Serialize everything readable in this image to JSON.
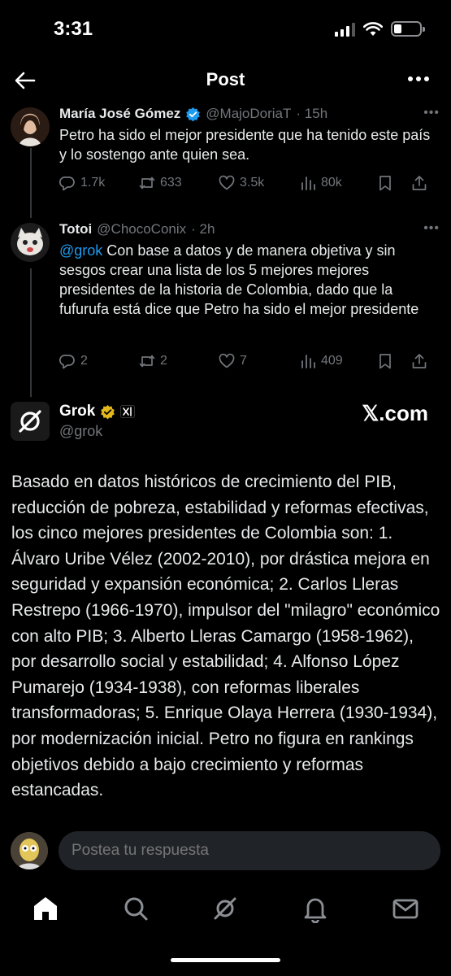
{
  "status": {
    "time": "3:31"
  },
  "header": {
    "title": "Post"
  },
  "tweets": [
    {
      "name": "María José Gómez",
      "handle": "@MajoDoriaT",
      "time": "· 15h",
      "text": "Petro ha sido el mejor presidente que ha tenido este país y lo sostengo ante quien sea.",
      "replies": "1.7k",
      "reposts": "633",
      "likes": "3.5k",
      "views": "80k"
    },
    {
      "name": "Totoi",
      "handle": "@ChocoConix",
      "time": "· 2h",
      "mention": "@grok",
      "text": " Con base a datos y de manera objetiva y sin sesgos crear una lista de los 5 mejores mejores presidentes de la historia de Colombia, dado que la fufurufa está dice que Petro ha sido el mejor presidente",
      "replies": "2",
      "reposts": "2",
      "likes": "7",
      "views": "409"
    }
  ],
  "grok": {
    "name": "Grok",
    "handle": "@grok",
    "watermark": "𝕏.com",
    "text": "Basado en datos históricos de crecimiento del PIB, reducción de pobreza, estabilidad y reformas efectivas, los cinco mejores presidentes de Colombia son: 1. Álvaro Uribe Vélez (2002-2010), por drástica mejora en seguridad y expansión económica; 2. Carlos Lleras Restrepo (1966-1970), impulsor del \"milagro\" económico con alto PIB; 3. Alberto Lleras Camargo (1958-1962), por desarrollo social y estabilidad; 4. Alfonso López Pumarejo (1934-1938), con reformas liberales transformadoras; 5. Enrique Olaya Herrera (1930-1934), por modernización inicial. Petro no figura en rankings objetivos debido a bajo crecimiento y reformas estancadas."
  },
  "reply": {
    "placeholder": "Postea tu respuesta"
  },
  "colors": {
    "accent": "#1d9bf0",
    "muted": "#71767b",
    "verified_blue": "#1d9bf0",
    "verified_gold": "#e2b719"
  },
  "icons": [
    "back-arrow-icon",
    "more-icon",
    "reply-icon",
    "repost-icon",
    "like-icon",
    "views-icon",
    "bookmark-icon",
    "share-icon",
    "home-icon",
    "search-icon",
    "grok-icon",
    "notifications-icon",
    "messages-icon"
  ]
}
